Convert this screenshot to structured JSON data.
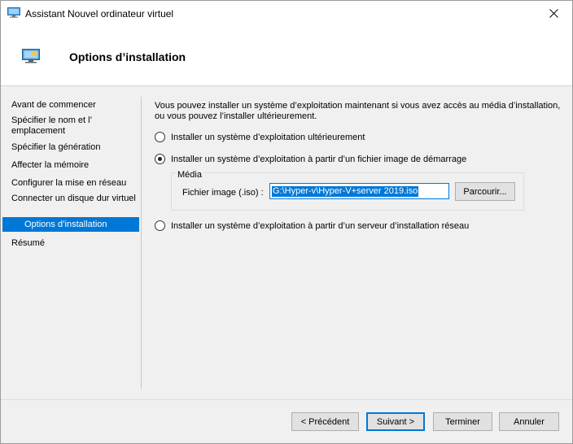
{
  "window": {
    "title": "Assistant Nouvel ordinateur virtuel",
    "close_glyph": "✕"
  },
  "header": {
    "title": "Options d’installation"
  },
  "sidebar": {
    "items": [
      {
        "label": "Avant de commencer"
      },
      {
        "label": "Spécifier le nom et l’ emplacement"
      },
      {
        "label": "Spécifier la génération"
      },
      {
        "label": "Affecter la mémoire"
      },
      {
        "label": "Configurer la mise en réseau"
      },
      {
        "label": "Connecter un disque dur virtuel"
      },
      {
        "label": "Options d’installation",
        "active": true
      },
      {
        "label": "Résumé"
      }
    ]
  },
  "main": {
    "description": "Vous pouvez installer un système d’exploitation maintenant si vous avez accès au média d’installation, ou vous pouvez l’installer ultérieurement.",
    "options": [
      {
        "label": "Installer un système d’exploitation ultérieurement",
        "selected": false
      },
      {
        "label": "Installer un système d’exploitation à partir d’un fichier image de démarrage",
        "selected": true
      },
      {
        "label": "Installer un système d’exploitation à partir d’un serveur d’installation réseau",
        "selected": false
      }
    ],
    "media": {
      "legend": "Média",
      "iso_label": "Fichier image (.iso) :",
      "iso_value": "G:\\Hyper-v\\Hyper-V+server 2019.iso",
      "browse_label": "Parcourir..."
    }
  },
  "footer": {
    "previous_label": "< Précédent",
    "next_label": "Suivant >",
    "finish_label": "Terminer",
    "cancel_label": "Annuler"
  },
  "colors": {
    "accent": "#0078d7",
    "panel_bg": "#f0f0f0"
  }
}
